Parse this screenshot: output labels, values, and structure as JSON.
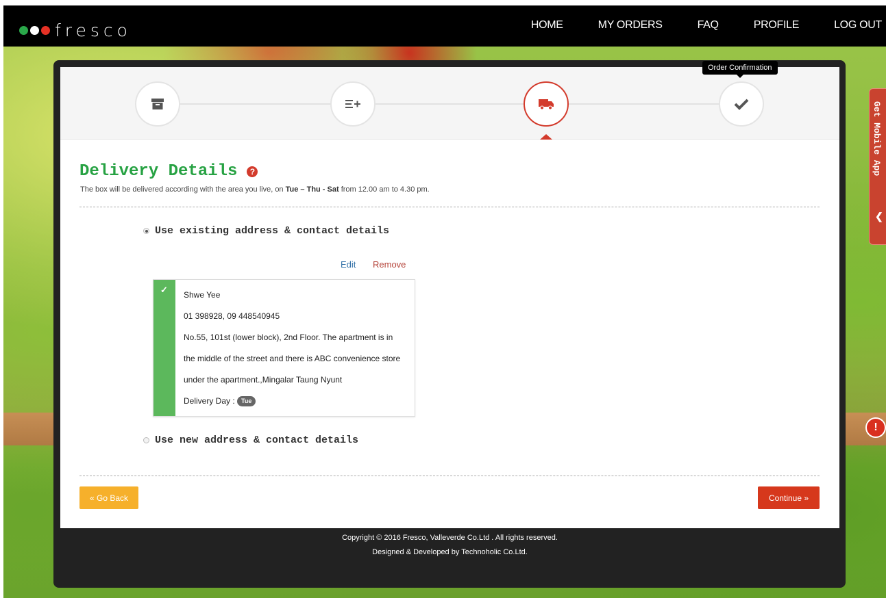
{
  "brand": {
    "name": "fresco",
    "dot_colors": [
      "#2aa84a",
      "#ffffff",
      "#e53125"
    ]
  },
  "nav": {
    "items": [
      "HOME",
      "MY ORDERS",
      "FAQ",
      "PROFILE",
      "LOG OUT"
    ]
  },
  "steps": {
    "items": [
      {
        "icon": "archive-box-icon",
        "state": "done"
      },
      {
        "icon": "list-add-icon",
        "state": "done"
      },
      {
        "icon": "delivery-truck-icon",
        "state": "active"
      },
      {
        "icon": "checkmark-icon",
        "state": "upcoming"
      }
    ],
    "tooltip": "Order Confirmation"
  },
  "delivery": {
    "title": "Delivery Details",
    "help_icon": "question-icon",
    "subtext_prefix": "The box will be delivered according with the area you live, on ",
    "subtext_days": "Tue – Thu - Sat",
    "subtext_suffix": " from 12.00 am to 4.30 pm.",
    "option_existing": "Use existing address & contact details",
    "option_new": "Use new address & contact details",
    "selected_option": "existing"
  },
  "address_card": {
    "edit_label": "Edit",
    "remove_label": "Remove",
    "name": "Shwe Yee",
    "phones": "01 398928, 09 448540945",
    "address_line1": "No.55, 101st (lower block), 2nd Floor. The apartment is in",
    "address_line2": "the middle of the street and there is ABC convenience store",
    "address_line3": "under the apartment.,Mingalar Taung Nyunt",
    "delivery_day_label": "Delivery Day :",
    "delivery_day": "Tue"
  },
  "buttons": {
    "back": "« Go Back",
    "continue": "Continue »"
  },
  "footer": {
    "copyright": "Copyright © 2016 Fresco, Valleverde Co.Ltd . All rights reserved.",
    "designed": "Designed & Developed by Technoholic Co.Ltd."
  },
  "side_tab": {
    "label": "Get Mobile App"
  },
  "alert": {
    "symbol": "!"
  },
  "colors": {
    "accent_green": "#27a243",
    "accent_red": "#d33b2c",
    "back_button": "#f6b02b",
    "continue_button": "#d6381c",
    "card_bar": "#5cb85c"
  }
}
